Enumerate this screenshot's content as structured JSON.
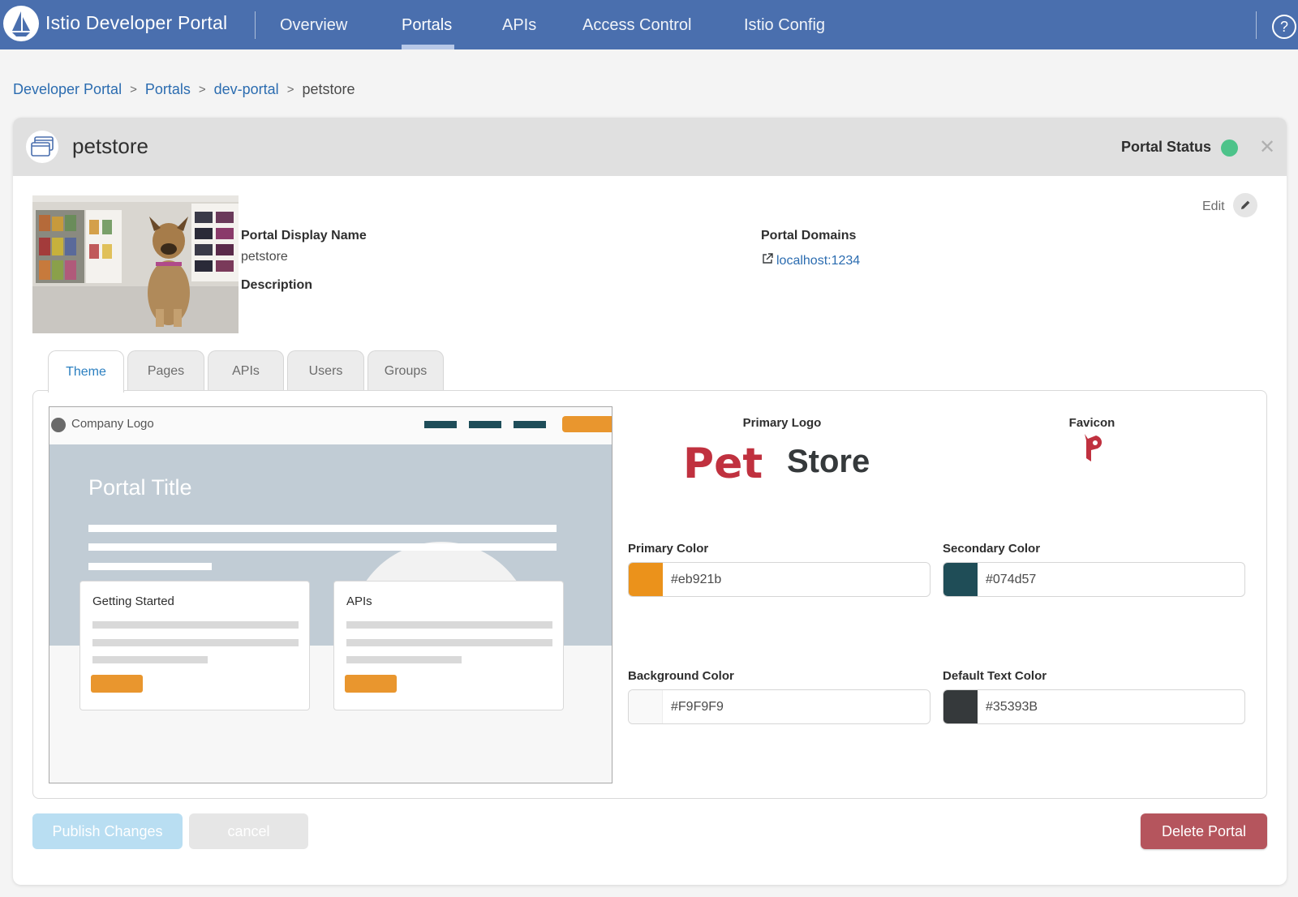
{
  "topbar": {
    "brand_title": "Istio Developer Portal",
    "nav": [
      "Overview",
      "Portals",
      "APIs",
      "Access Control",
      "Istio Config"
    ],
    "active_nav": "Portals",
    "help_label": "?"
  },
  "breadcrumb": {
    "items": [
      "Developer Portal",
      "Portals",
      "dev-portal"
    ],
    "separator": ">",
    "current": "petstore"
  },
  "portal": {
    "name": "petstore",
    "status_label": "Portal Status",
    "status_color": "#4dc38a",
    "edit_label": "Edit",
    "display_name_label": "Portal Display Name",
    "display_name": "petstore",
    "description_label": "Description",
    "domains_label": "Portal Domains",
    "domain": "localhost:1234"
  },
  "tabs": [
    "Theme",
    "Pages",
    "APIs",
    "Users",
    "Groups"
  ],
  "active_tab": "Theme",
  "preview": {
    "company_logo": "Company Logo",
    "portal_title": "Portal Title",
    "card1_title": "Getting Started",
    "card2_title": "APIs"
  },
  "theme": {
    "primary_logo_label": "Primary Logo",
    "favicon_label": "Favicon",
    "logo_text_pet": "Pet",
    "logo_text_store": "Store",
    "primary_color_label": "Primary Color",
    "primary_color": "#eb921b",
    "secondary_color_label": "Secondary Color",
    "secondary_color": "#074d57",
    "background_color_label": "Background Color",
    "background_color": "#F9F9F9",
    "text_color_label": "Default Text Color",
    "text_color": "#35393B"
  },
  "actions": {
    "publish": "Publish Changes",
    "cancel": "cancel",
    "delete": "Delete Portal"
  }
}
